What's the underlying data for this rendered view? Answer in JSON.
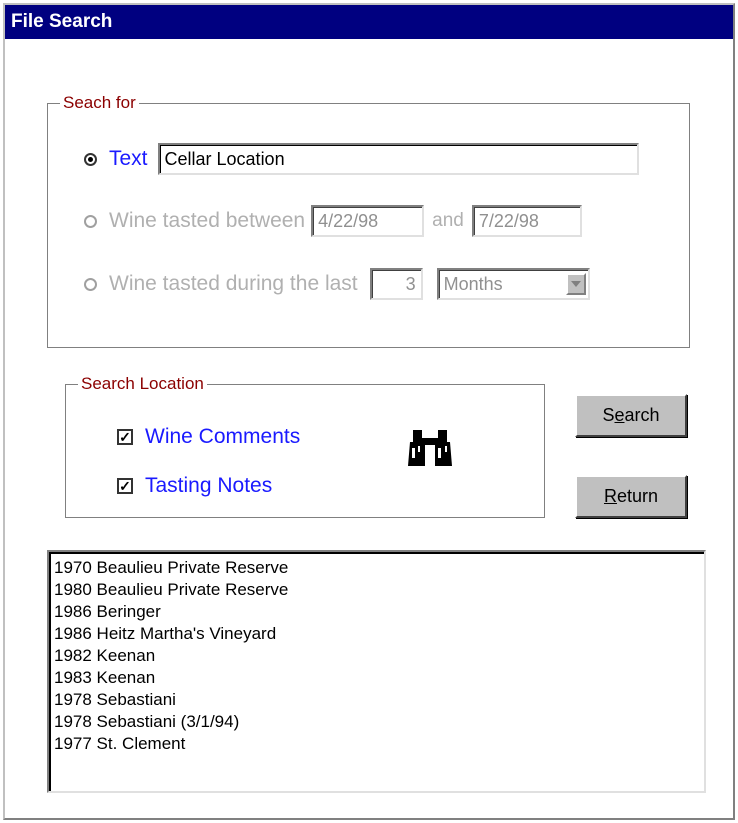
{
  "window": {
    "title": "File Search"
  },
  "search_for": {
    "label": "Seach for",
    "text_option": {
      "label": "Text",
      "value": "Cellar Location",
      "selected": true
    },
    "between_option": {
      "label": "Wine tasted between",
      "from": "4/22/98",
      "and_label": "and",
      "to": "7/22/98",
      "selected": false
    },
    "during_option": {
      "label": "Wine tasted during the last",
      "count": "3",
      "unit": "Months",
      "selected": false
    }
  },
  "search_location": {
    "label": "Search Location",
    "wine_comments": {
      "label": "Wine Comments",
      "checked": true
    },
    "tasting_notes": {
      "label": "Tasting Notes",
      "checked": true
    },
    "icon": "binoculars-icon"
  },
  "buttons": {
    "search": {
      "pre": "S",
      "accel": "e",
      "post": "arch"
    },
    "return": {
      "pre": "",
      "accel": "R",
      "post": "eturn"
    }
  },
  "results": [
    "1970 Beaulieu Private Reserve",
    "1980 Beaulieu Private Reserve",
    "1986 Beringer",
    "1986 Heitz Martha's Vineyard",
    "1982 Keenan",
    "1983 Keenan",
    "1978 Sebastiani",
    "1978 Sebastiani (3/1/94)",
    "1977 St. Clement"
  ],
  "colors": {
    "titlebar": "#000080",
    "group_label": "#8b0000",
    "active_label": "#1a1aff",
    "disabled": "#b0b0b0"
  }
}
